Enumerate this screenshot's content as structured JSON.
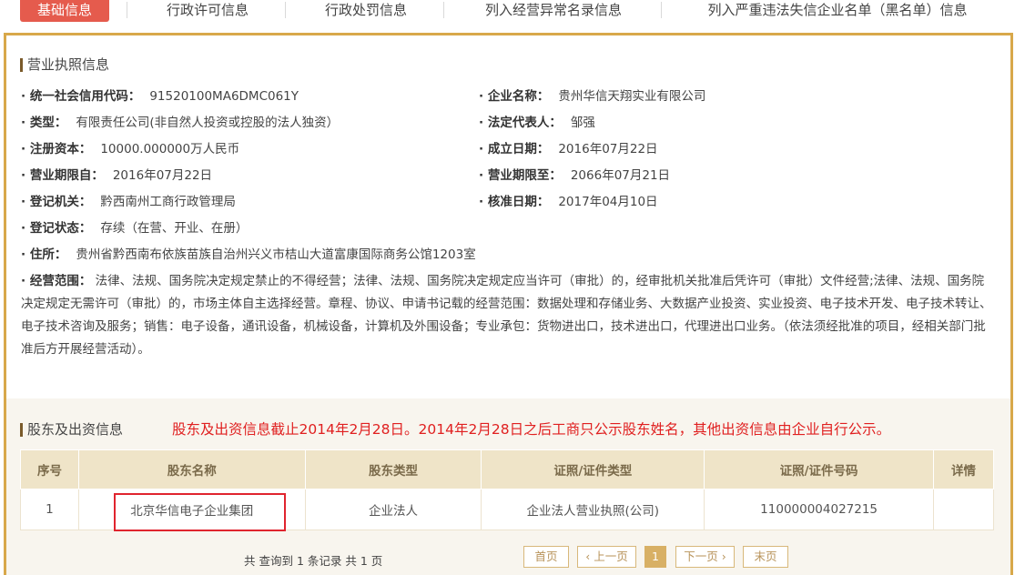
{
  "tabs": [
    {
      "label": "基础信息"
    },
    {
      "label": "行政许可信息"
    },
    {
      "label": "行政处罚信息"
    },
    {
      "label": "列入经营异常名录信息"
    },
    {
      "label": "列入严重违法失信企业名单（黑名单）信息"
    }
  ],
  "license": {
    "title": "营业执照信息",
    "rows": [
      {
        "label": "统一社会信用代码：",
        "value": "91520100MA6DMC061Y"
      },
      {
        "label": "企业名称：",
        "value": "贵州华信天翔实业有限公司"
      },
      {
        "label": "类型：",
        "value": "有限责任公司(非自然人投资或控股的法人独资）"
      },
      {
        "label": "法定代表人：",
        "value": "邹强"
      },
      {
        "label": "注册资本：",
        "value": "10000.000000万人民币"
      },
      {
        "label": "成立日期：",
        "value": "2016年07月22日"
      },
      {
        "label": "营业期限自：",
        "value": "2016年07月22日"
      },
      {
        "label": "营业期限至：",
        "value": "2066年07月21日"
      },
      {
        "label": "登记机关：",
        "value": "黔西南州工商行政管理局"
      },
      {
        "label": "核准日期：",
        "value": "2017年04月10日"
      },
      {
        "label": "登记状态：",
        "value": "存续（在营、开业、在册）"
      },
      {
        "label": "住所：",
        "value": "贵州省黔西南布依族苗族自治州兴义市桔山大道富康国际商务公馆1203室"
      }
    ],
    "scope_label": "经营范围：",
    "scope_text": "法律、法规、国务院决定规定禁止的不得经营；法律、法规、国务院决定规定应当许可（审批）的，经审批机关批准后凭许可（审批）文件经营;法律、法规、国务院决定规定无需许可（审批）的，市场主体自主选择经营。章程、协议、申请书记载的经营范围：数据处理和存储业务、大数据产业投资、实业投资、电子技术开发、电子技术转让、电子技术咨询及服务；销售：电子设备，通讯设备，机械设备，计算机及外围设备；专业承包：货物进出口，技术进出口，代理进出口业务。（依法须经批准的项目，经相关部门批准后方开展经营活动）。"
  },
  "shareholders": {
    "title": "股东及出资信息",
    "notice": "股东及出资信息截止2014年2月28日。2014年2月28日之后工商只公示股东姓名，其他出资信息由企业自行公示。",
    "headers": [
      "序号",
      "股东名称",
      "股东类型",
      "证照/证件类型",
      "证照/证件号码",
      "详情"
    ],
    "rows": [
      [
        "1",
        "北京华信电子企业集团",
        "企业法人",
        "企业法人营业执照(公司)",
        "110000004027215",
        ""
      ]
    ],
    "summary": "共 查询到 1 条记录 共 1 页",
    "pager": {
      "first": "首页",
      "prev": "上一页",
      "current": "1",
      "next": "下一页",
      "last": "末页"
    }
  },
  "colors": {
    "accent_tab": "#e55b4d",
    "frame_gold": "#d8a84a",
    "notice_red": "#e02020",
    "highlight_red": "#e0242e"
  }
}
